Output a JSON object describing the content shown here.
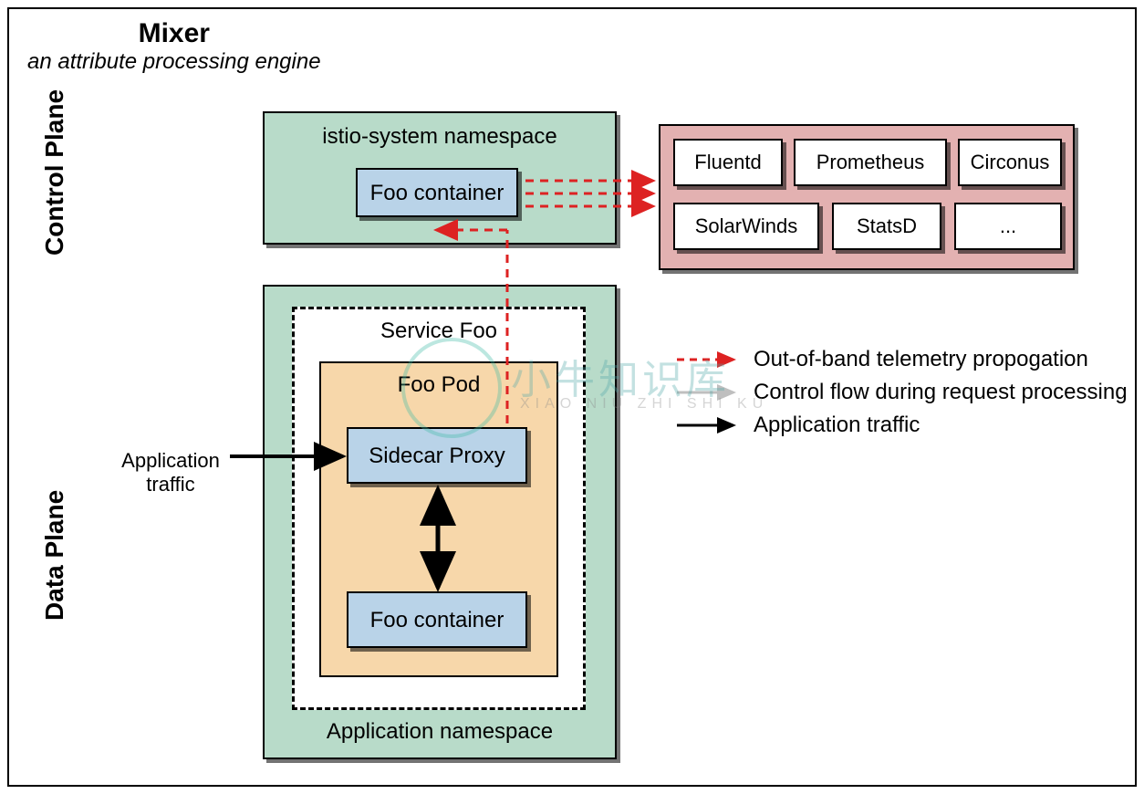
{
  "title": {
    "main": "Mixer",
    "sub": "an attribute processing engine"
  },
  "planes": {
    "control": "Control Plane",
    "data": "Data Plane"
  },
  "control_plane": {
    "namespace_label": "istio-system namespace",
    "foo_container": "Foo container"
  },
  "adapters": {
    "row1": [
      "Fluentd",
      "Prometheus",
      "Circonus"
    ],
    "row2": [
      "SolarWinds",
      "StatsD",
      "..."
    ]
  },
  "data_plane": {
    "app_namespace": "Application namespace",
    "service": "Service Foo",
    "pod": "Foo Pod",
    "sidecar": "Sidecar Proxy",
    "foo_container": "Foo container"
  },
  "app_traffic_label": {
    "l1": "Application",
    "l2": "traffic"
  },
  "legend": {
    "oob": "Out-of-band telemetry propogation",
    "ctrl": "Control flow during request processing",
    "app": "Application traffic"
  },
  "watermark": {
    "big": "小牛知识库",
    "sub": "XIAO NIU ZHI SHI KU"
  },
  "colors": {
    "green": "#b8dbc9",
    "blue": "#b9d3e8",
    "orange": "#f7d7aa",
    "pink": "#e3b1b1",
    "red": "#d22",
    "gray": "#bfbfbf"
  }
}
